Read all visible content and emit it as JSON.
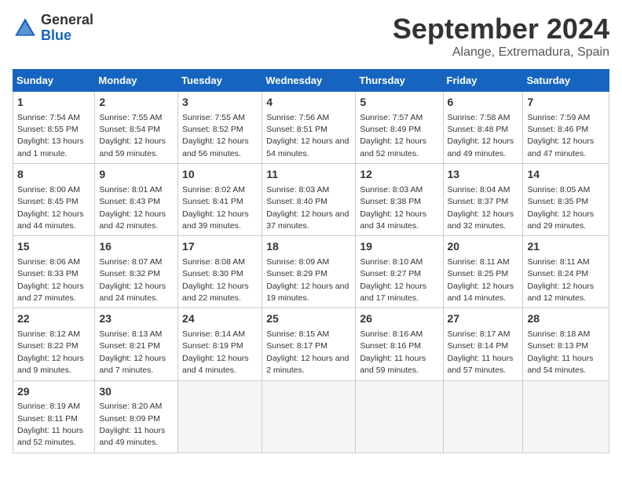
{
  "logo": {
    "general": "General",
    "blue": "Blue"
  },
  "title": "September 2024",
  "subtitle": "Alange, Extremadura, Spain",
  "headers": [
    "Sunday",
    "Monday",
    "Tuesday",
    "Wednesday",
    "Thursday",
    "Friday",
    "Saturday"
  ],
  "weeks": [
    [
      {
        "day": "1",
        "rise": "7:54 AM",
        "set": "8:55 PM",
        "daylight": "13 hours and 1 minute."
      },
      {
        "day": "2",
        "rise": "7:55 AM",
        "set": "8:54 PM",
        "daylight": "12 hours and 59 minutes."
      },
      {
        "day": "3",
        "rise": "7:55 AM",
        "set": "8:52 PM",
        "daylight": "12 hours and 56 minutes."
      },
      {
        "day": "4",
        "rise": "7:56 AM",
        "set": "8:51 PM",
        "daylight": "12 hours and 54 minutes."
      },
      {
        "day": "5",
        "rise": "7:57 AM",
        "set": "8:49 PM",
        "daylight": "12 hours and 52 minutes."
      },
      {
        "day": "6",
        "rise": "7:58 AM",
        "set": "8:48 PM",
        "daylight": "12 hours and 49 minutes."
      },
      {
        "day": "7",
        "rise": "7:59 AM",
        "set": "8:46 PM",
        "daylight": "12 hours and 47 minutes."
      }
    ],
    [
      {
        "day": "8",
        "rise": "8:00 AM",
        "set": "8:45 PM",
        "daylight": "12 hours and 44 minutes."
      },
      {
        "day": "9",
        "rise": "8:01 AM",
        "set": "8:43 PM",
        "daylight": "12 hours and 42 minutes."
      },
      {
        "day": "10",
        "rise": "8:02 AM",
        "set": "8:41 PM",
        "daylight": "12 hours and 39 minutes."
      },
      {
        "day": "11",
        "rise": "8:03 AM",
        "set": "8:40 PM",
        "daylight": "12 hours and 37 minutes."
      },
      {
        "day": "12",
        "rise": "8:03 AM",
        "set": "8:38 PM",
        "daylight": "12 hours and 34 minutes."
      },
      {
        "day": "13",
        "rise": "8:04 AM",
        "set": "8:37 PM",
        "daylight": "12 hours and 32 minutes."
      },
      {
        "day": "14",
        "rise": "8:05 AM",
        "set": "8:35 PM",
        "daylight": "12 hours and 29 minutes."
      }
    ],
    [
      {
        "day": "15",
        "rise": "8:06 AM",
        "set": "8:33 PM",
        "daylight": "12 hours and 27 minutes."
      },
      {
        "day": "16",
        "rise": "8:07 AM",
        "set": "8:32 PM",
        "daylight": "12 hours and 24 minutes."
      },
      {
        "day": "17",
        "rise": "8:08 AM",
        "set": "8:30 PM",
        "daylight": "12 hours and 22 minutes."
      },
      {
        "day": "18",
        "rise": "8:09 AM",
        "set": "8:29 PM",
        "daylight": "12 hours and 19 minutes."
      },
      {
        "day": "19",
        "rise": "8:10 AM",
        "set": "8:27 PM",
        "daylight": "12 hours and 17 minutes."
      },
      {
        "day": "20",
        "rise": "8:11 AM",
        "set": "8:25 PM",
        "daylight": "12 hours and 14 minutes."
      },
      {
        "day": "21",
        "rise": "8:11 AM",
        "set": "8:24 PM",
        "daylight": "12 hours and 12 minutes."
      }
    ],
    [
      {
        "day": "22",
        "rise": "8:12 AM",
        "set": "8:22 PM",
        "daylight": "12 hours and 9 minutes."
      },
      {
        "day": "23",
        "rise": "8:13 AM",
        "set": "8:21 PM",
        "daylight": "12 hours and 7 minutes."
      },
      {
        "day": "24",
        "rise": "8:14 AM",
        "set": "8:19 PM",
        "daylight": "12 hours and 4 minutes."
      },
      {
        "day": "25",
        "rise": "8:15 AM",
        "set": "8:17 PM",
        "daylight": "12 hours and 2 minutes."
      },
      {
        "day": "26",
        "rise": "8:16 AM",
        "set": "8:16 PM",
        "daylight": "11 hours and 59 minutes."
      },
      {
        "day": "27",
        "rise": "8:17 AM",
        "set": "8:14 PM",
        "daylight": "11 hours and 57 minutes."
      },
      {
        "day": "28",
        "rise": "8:18 AM",
        "set": "8:13 PM",
        "daylight": "11 hours and 54 minutes."
      }
    ],
    [
      {
        "day": "29",
        "rise": "8:19 AM",
        "set": "8:11 PM",
        "daylight": "11 hours and 52 minutes."
      },
      {
        "day": "30",
        "rise": "8:20 AM",
        "set": "8:09 PM",
        "daylight": "11 hours and 49 minutes."
      },
      null,
      null,
      null,
      null,
      null
    ]
  ]
}
